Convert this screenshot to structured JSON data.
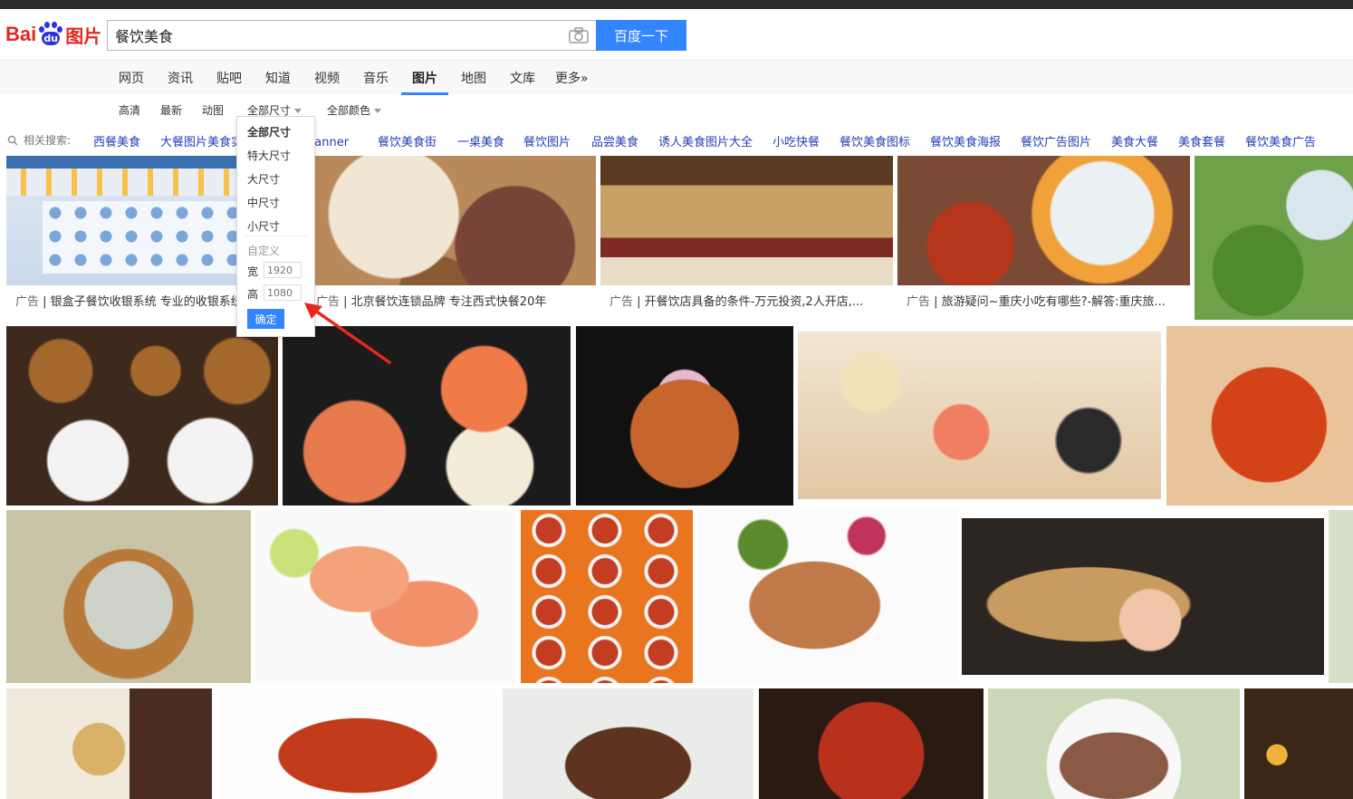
{
  "logo": {
    "brand": "Bai",
    "paw_text": "du",
    "product": "图片"
  },
  "search": {
    "value": "餐饮美食",
    "button": "百度一下"
  },
  "nav": [
    {
      "label": "网页"
    },
    {
      "label": "资讯"
    },
    {
      "label": "贴吧"
    },
    {
      "label": "知道"
    },
    {
      "label": "视频"
    },
    {
      "label": "音乐"
    },
    {
      "label": "图片",
      "active": true
    },
    {
      "label": "地图"
    },
    {
      "label": "文库"
    },
    {
      "label": "更多»"
    }
  ],
  "filters": {
    "hd": "高清",
    "latest": "最新",
    "animated": "动图",
    "size": "全部尺寸",
    "color": "全部颜色"
  },
  "related": {
    "label": "相关搜索:",
    "links": [
      "西餐美食",
      "大餐图片美食实拍",
      "美食banner",
      "餐饮美食街",
      "一桌美食",
      "餐饮图片",
      "品尝美食",
      "诱人美食图片大全",
      "小吃快餐",
      "餐饮美食图标",
      "餐饮美食海报",
      "餐饮广告图片",
      "美食大餐",
      "美食套餐",
      "餐饮美食广告"
    ]
  },
  "size_dropdown": {
    "options": [
      "全部尺寸",
      "特大尺寸",
      "大尺寸",
      "中尺寸",
      "小尺寸"
    ],
    "custom_label": "自定义",
    "width_label": "宽",
    "width_placeholder": "1920",
    "height_label": "高",
    "height_placeholder": "1080",
    "confirm": "确定"
  },
  "ads": [
    {
      "tag": "广告",
      "text": "银盒子餐饮收银系统 专业的收银系统"
    },
    {
      "tag": "广告",
      "text": "北京餐饮连锁品牌 专注西式快餐20年"
    },
    {
      "tag": "广告",
      "text": "开餐饮店具备的条件-万元投资,2人开店,..."
    },
    {
      "tag": "广告",
      "text": "旅游疑问~重庆小吃有哪些?-解答:重庆旅..."
    }
  ],
  "colors": {
    "accent": "#3385ff",
    "brand_red": "#de2a1f",
    "link": "#2440b3"
  }
}
